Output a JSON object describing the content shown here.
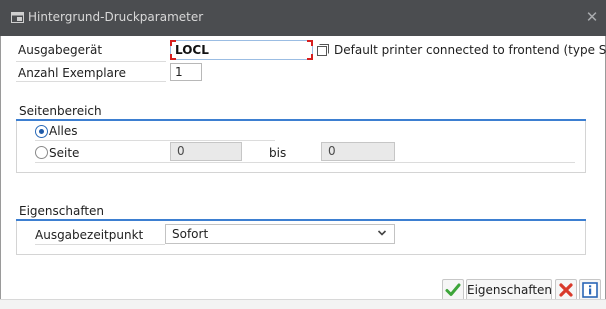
{
  "window": {
    "title": "Hintergrund-Druckparameter",
    "close_glyph": "✕"
  },
  "output": {
    "device_label": "Ausgabegerät",
    "device_value": "LOCL",
    "device_description": "Default printer connected to frontend (type S..",
    "copies_label": "Anzahl Exemplare",
    "copies_value": "1"
  },
  "page_range": {
    "header": "Seitenbereich",
    "all_label": "Alles",
    "all_selected": true,
    "page_label": "Seite",
    "page_from": "0",
    "to_label": "bis",
    "page_to": "0"
  },
  "properties": {
    "header": "Eigenschaften",
    "output_time_label": "Ausgabezeitpunkt",
    "output_time_value": "Sofort"
  },
  "footer": {
    "properties_button_label": "Eigenschaften",
    "confirm_icon": "checkmark-icon",
    "cancel_icon": "cancel-icon",
    "info_icon": "info-icon"
  },
  "colors": {
    "titlebar": "#4b4d50",
    "accent_blue": "#3d7fd1",
    "confirm_green": "#3da53a",
    "cancel_red": "#d93a2b"
  }
}
